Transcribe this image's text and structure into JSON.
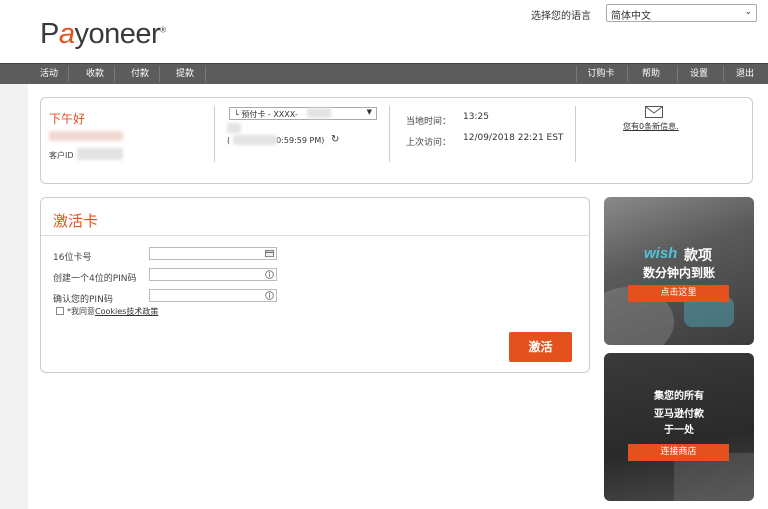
{
  "header": {
    "logo_pre": "P",
    "logo_a": "a",
    "logo_post": "yoneer",
    "logo_tm": "®",
    "language_label": "选择您的语言",
    "language_value": "简体中文"
  },
  "nav": {
    "left": [
      "活动",
      "收款",
      "付款",
      "提款"
    ],
    "right": [
      "订购卡",
      "帮助",
      "设置",
      "退出"
    ]
  },
  "account": {
    "greeting": "下午好",
    "customer_id_label": "客户ID",
    "card_select": "└ 预付卡 - XXXX-",
    "time_suffix": "0:59:59 PM)",
    "time_prefix": "(",
    "current_time_label": "当地时间：",
    "current_time_value": "13:25",
    "last_visit_label": "上次访问：",
    "last_visit_value": "12/09/2018 22:21 EST",
    "messages": "您有0条新信息."
  },
  "activate": {
    "title": "激活卡",
    "fields": [
      {
        "label": "16位卡号",
        "icon": "card-icon"
      },
      {
        "label": "创建一个4位的PIN码",
        "icon": "info-icon"
      },
      {
        "label": "确认您的PIN码",
        "icon": "info-icon"
      }
    ],
    "agree_prefix": "*我同意",
    "agree_link": "Cookies技术政策",
    "button": "激活"
  },
  "ads": {
    "ad1": {
      "brand": "wish",
      "title": "款项",
      "line2": "数分钟内到账",
      "button": "点击这里"
    },
    "ad2": {
      "line1": "集您的所有",
      "line2": "亚马逊付款",
      "line3": "于一处",
      "button": "连接商店"
    }
  },
  "colors": {
    "accent": "#e5511e",
    "nav": "#5c5c5c",
    "wish": "#4fc3d9"
  }
}
